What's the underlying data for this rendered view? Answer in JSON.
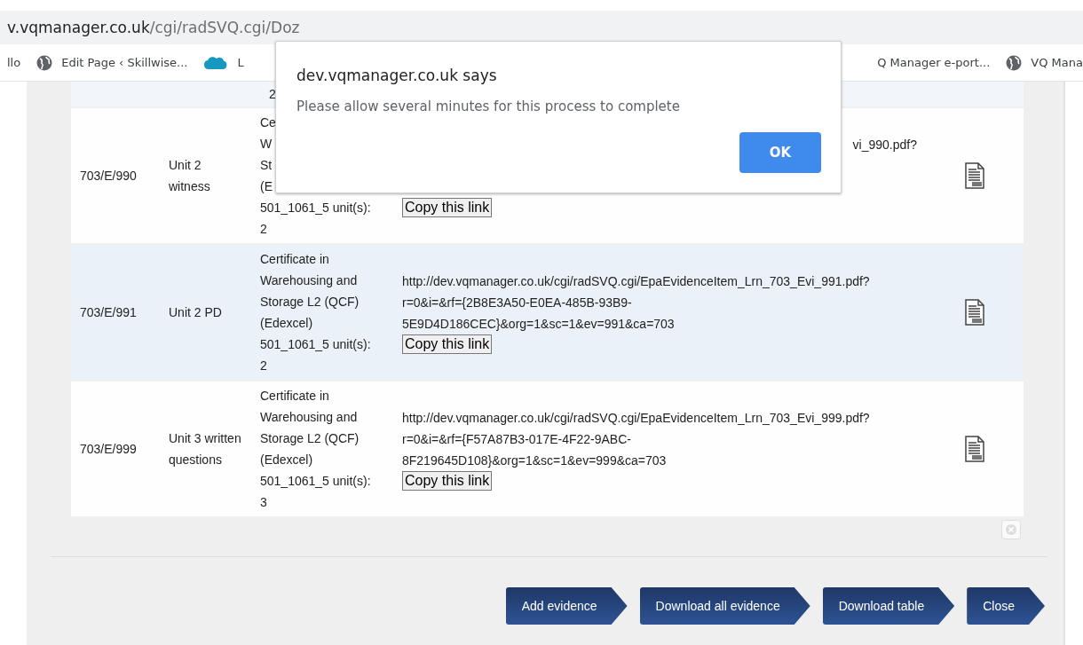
{
  "browser": {
    "address_host": "v.vqmanager.co.uk",
    "address_path": "/cgi/radSVQ.cgi/Doz"
  },
  "bookmarks": [
    {
      "kind": "plain",
      "label": "llo"
    },
    {
      "kind": "globe",
      "label": "Edit Page ‹ Skillwise..."
    },
    {
      "kind": "cloud",
      "label": "L"
    },
    {
      "kind": "plain",
      "label": "Q Manager e-port..."
    },
    {
      "kind": "globe",
      "label": "VQ Mana"
    }
  ],
  "table": {
    "partial_row": {
      "qualification": "2"
    },
    "rows": [
      {
        "id": "703/E/990",
        "name": "Unit 2 witness",
        "qualification": [
          "Ce",
          "W",
          "St",
          "(E",
          "501_1061_5 unit(s):",
          "2"
        ],
        "link": [
          "vi_990.pdf?"
        ],
        "copy_button": "Copy this link",
        "highlighted": false
      },
      {
        "id": "703/E/991",
        "name": "Unit 2 PD",
        "qualification": [
          "Certificate in",
          "Warehousing and",
          "Storage L2 (QCF)",
          "(Edexcel)",
          "501_1061_5 unit(s):",
          "2"
        ],
        "link": [
          "http://dev.vqmanager.co.uk/cgi/radSVQ.cgi/EpaEvidenceItem_Lrn_703_Evi_991.pdf?",
          "r=0&i=&rf={2B8E3A50-E0EA-485B-93B9-",
          "5E9D4D186CEC}&org=1&sc=1&ev=991&ca=703"
        ],
        "copy_button": "Copy this link",
        "highlighted": true
      },
      {
        "id": "703/E/999",
        "name": "Unit 3 written questions",
        "qualification": [
          "Certificate in",
          "Warehousing and",
          "Storage L2 (QCF)",
          "(Edexcel)",
          "501_1061_5 unit(s):",
          "3"
        ],
        "link": [
          "http://dev.vqmanager.co.uk/cgi/radSVQ.cgi/EpaEvidenceItem_Lrn_703_Evi_999.pdf?",
          "r=0&i=&rf={F57A87B3-017E-4F22-9ABC-",
          "8F219645D108}&org=1&sc=1&ev=999&ca=703"
        ],
        "copy_button": "Copy this link",
        "highlighted": false
      }
    ]
  },
  "buttons": [
    "Add evidence",
    "Download all evidence",
    "Download table",
    "Close"
  ],
  "dialog": {
    "title": "dev.vqmanager.co.uk says",
    "message": "Please allow several minutes for this process to complete",
    "ok": "OK"
  }
}
